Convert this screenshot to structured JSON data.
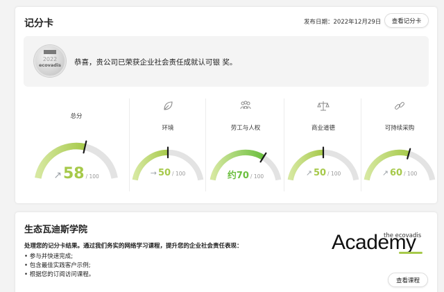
{
  "scorecard": {
    "title": "记分卡",
    "date_label": "发布日期：2022年12月29日",
    "view_button": "查看记分卡",
    "banner": {
      "message": "恭喜，贵公司已荣获企业社会责任成就认可银 奖。",
      "medal_year": "2022",
      "medal_logo": "ecovadis"
    },
    "overall": {
      "label": "总分",
      "score": "58",
      "max": "/ 100",
      "fraction": 0.58,
      "trend": "↗"
    },
    "themes": [
      {
        "label": "环境",
        "score": "50",
        "max": "/ 100",
        "fraction": 0.5,
        "trend": "→",
        "icon": "leaf-icon"
      },
      {
        "label": "劳工与人权",
        "score": "约70",
        "max": "/ 100",
        "fraction": 0.7,
        "trend": "",
        "icon": "people-icon"
      },
      {
        "label": "商业道德",
        "score": "50",
        "max": "/ 100",
        "fraction": 0.5,
        "trend": "↗",
        "icon": "scales-icon"
      },
      {
        "label": "可持续采购",
        "score": "60",
        "max": "/ 100",
        "fraction": 0.6,
        "trend": "↗",
        "icon": "link-icon"
      }
    ],
    "colors": {
      "gauge_fill": "#a6c94a",
      "gauge_fill_strong": "#6cbf3f",
      "gauge_track": "#e3e3e3",
      "marker": "#1a1a1a"
    }
  },
  "academy": {
    "title": "生态瓦迪斯学院",
    "lead": "处理您的记分卡结果。通过我们务实的网络学习课程，提升您的企业社会责任表现：",
    "bullets": [
      "参与并快速完成;",
      "包含最佳实践客户示例;",
      "根据您的订阅访问课程。"
    ],
    "logo_small": "the ecovadis",
    "logo_big": "Academy",
    "course_button": "查看课程"
  }
}
